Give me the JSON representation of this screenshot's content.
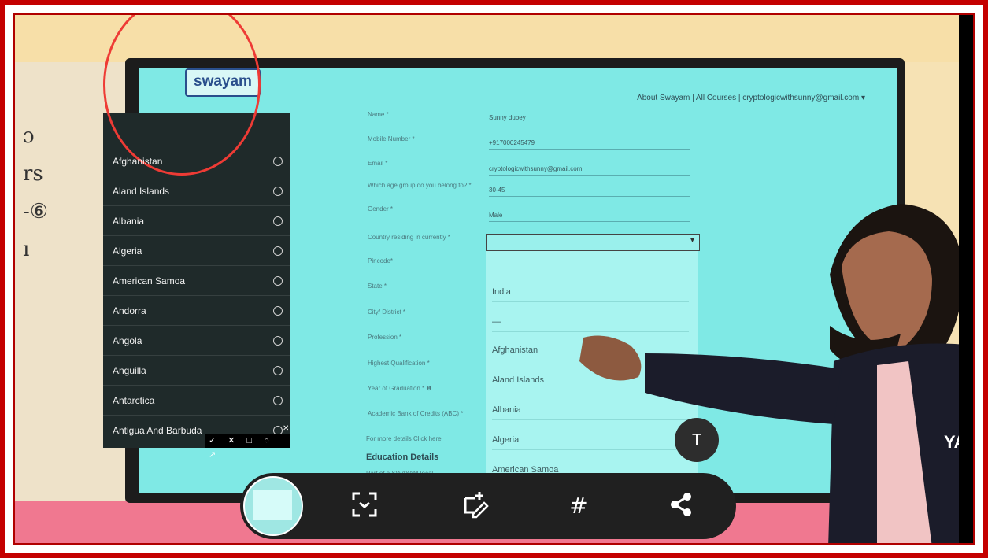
{
  "site": {
    "logo": "swayam",
    "nav": "About Swayam | All Courses | cryptologicwithsunny@gmail.com ▾"
  },
  "form": {
    "fields": [
      {
        "label": "Name *",
        "value": "Sunny dubey"
      },
      {
        "label": "Mobile Number *",
        "value": "+917000245479"
      },
      {
        "label": "Email *",
        "value": "cryptologicwithsunny@gmail.com"
      },
      {
        "label": "Which age group do you belong to? *",
        "value": "30-45"
      },
      {
        "label": "Gender *",
        "value": "Male"
      },
      {
        "label": "Country residing in currently *",
        "value": ""
      },
      {
        "label": "Pincode*",
        "value": ""
      },
      {
        "label": "State *",
        "value": ""
      },
      {
        "label": "City/ District *",
        "value": ""
      },
      {
        "label": "Profession *",
        "value": ""
      },
      {
        "label": "Highest Qualification *",
        "value": ""
      },
      {
        "label": "Year of Graduation * ❶",
        "value": ""
      },
      {
        "label": "Academic Bank of Credits (ABC) *",
        "value": ""
      }
    ],
    "abc_note": "For more details Click here",
    "section_title": "Education Details",
    "local_chapter": "Part of a SWAYAM local"
  },
  "country_dropdown": {
    "options": [
      "India",
      "—",
      "Afghanistan",
      "Aland Islands",
      "Albania",
      "Algeria",
      "American Samoa"
    ]
  },
  "overlay_list": {
    "items": [
      "Afghanistan",
      "Aland Islands",
      "Albania",
      "Algeria",
      "American Samoa",
      "Andorra",
      "Angola",
      "Anguilla",
      "Antarctica",
      "Antigua And Barbuda"
    ],
    "toolbar": "✓ ✕ □ ○ ↗"
  },
  "text_button": "T",
  "bottom_bar": {
    "icons": [
      "scan-icon",
      "edit-icon",
      "hashtag-icon",
      "share-icon"
    ]
  },
  "colors": {
    "frame": "#c40000",
    "screen": "#7fe9e5",
    "accent_arc": "#ee3b35"
  }
}
